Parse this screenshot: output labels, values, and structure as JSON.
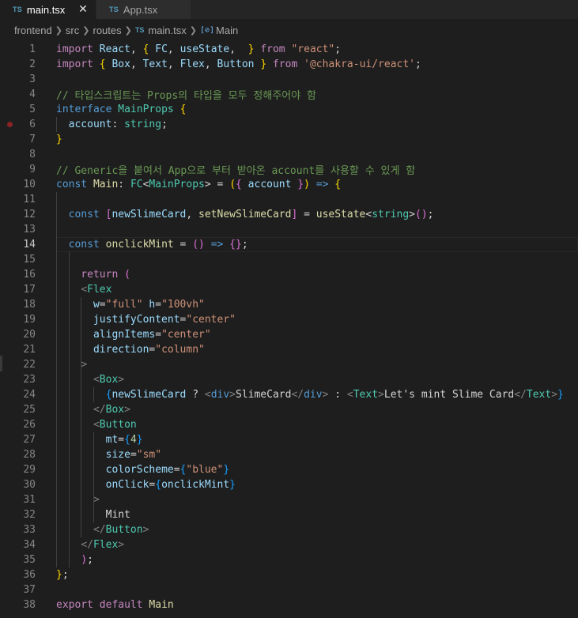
{
  "tabs": [
    {
      "badge": "TS",
      "label": "main.tsx",
      "active": true,
      "close": "✕"
    },
    {
      "badge": "TS",
      "label": "App.tsx",
      "active": false
    }
  ],
  "breadcrumb": {
    "parts": [
      "frontend",
      "src",
      "routes"
    ],
    "file_badge": "TS",
    "file": "main.tsx",
    "symbol_icon": "[⊘]",
    "symbol": "Main"
  },
  "editor": {
    "current_line": 14,
    "breakpoint_line": 6,
    "lines": [
      {
        "n": "1",
        "t": [
          [
            "ctl",
            "import"
          ],
          [
            "pl",
            " "
          ],
          [
            "var",
            "React"
          ],
          [
            "pl",
            ", "
          ],
          [
            "br1",
            "{"
          ],
          [
            "pl",
            " "
          ],
          [
            "var",
            "FC"
          ],
          [
            "pl",
            ", "
          ],
          [
            "var",
            "useState"
          ],
          [
            "pl",
            ",  "
          ],
          [
            "br1",
            "}"
          ],
          [
            "pl",
            " "
          ],
          [
            "ctl",
            "from"
          ],
          [
            "pl",
            " "
          ],
          [
            "str",
            "\"react\""
          ],
          [
            "pl",
            ";"
          ]
        ]
      },
      {
        "n": "2",
        "t": [
          [
            "ctl",
            "import"
          ],
          [
            "pl",
            " "
          ],
          [
            "br1",
            "{"
          ],
          [
            "pl",
            " "
          ],
          [
            "var",
            "Box"
          ],
          [
            "pl",
            ", "
          ],
          [
            "var",
            "Text"
          ],
          [
            "pl",
            ", "
          ],
          [
            "var",
            "Flex"
          ],
          [
            "pl",
            ", "
          ],
          [
            "var",
            "Button"
          ],
          [
            "pl",
            " "
          ],
          [
            "br1",
            "}"
          ],
          [
            "pl",
            " "
          ],
          [
            "ctl",
            "from"
          ],
          [
            "pl",
            " "
          ],
          [
            "str",
            "'@chakra-ui/react'"
          ],
          [
            "pl",
            ";"
          ]
        ]
      },
      {
        "n": "3",
        "t": []
      },
      {
        "n": "4",
        "t": [
          [
            "com",
            "// 타입스크립트는 Props의 타입을 모두 정해주어야 함"
          ]
        ]
      },
      {
        "n": "5",
        "t": [
          [
            "kw",
            "interface"
          ],
          [
            "pl",
            " "
          ],
          [
            "ty",
            "MainProps"
          ],
          [
            "pl",
            " "
          ],
          [
            "br1",
            "{"
          ]
        ]
      },
      {
        "n": "6",
        "t": [
          [
            "pl",
            "  "
          ],
          [
            "var",
            "account"
          ],
          [
            "pl",
            ": "
          ],
          [
            "ty",
            "string"
          ],
          [
            "pl",
            ";"
          ]
        ]
      },
      {
        "n": "7",
        "t": [
          [
            "br1",
            "}"
          ]
        ]
      },
      {
        "n": "8",
        "t": []
      },
      {
        "n": "9",
        "t": [
          [
            "com",
            "// Generic을 붙여서 App으로 부터 받아온 account를 사용할 수 있게 함"
          ]
        ]
      },
      {
        "n": "10",
        "t": [
          [
            "kw",
            "const"
          ],
          [
            "pl",
            " "
          ],
          [
            "fn",
            "Main"
          ],
          [
            "pl",
            ": "
          ],
          [
            "ty",
            "FC"
          ],
          [
            "pl",
            "<"
          ],
          [
            "ty",
            "MainProps"
          ],
          [
            "pl",
            "> = "
          ],
          [
            "br1",
            "("
          ],
          [
            "br2",
            "{"
          ],
          [
            "pl",
            " "
          ],
          [
            "var",
            "account"
          ],
          [
            "pl",
            " "
          ],
          [
            "br2",
            "}"
          ],
          [
            "br1",
            ")"
          ],
          [
            "pl",
            " "
          ],
          [
            "kw",
            "=>"
          ],
          [
            "pl",
            " "
          ],
          [
            "br1",
            "{"
          ]
        ]
      },
      {
        "n": "11",
        "t": []
      },
      {
        "n": "12",
        "t": [
          [
            "pl",
            "  "
          ],
          [
            "kw",
            "const"
          ],
          [
            "pl",
            " "
          ],
          [
            "br2",
            "["
          ],
          [
            "var",
            "newSlimeCard"
          ],
          [
            "pl",
            ", "
          ],
          [
            "fn",
            "setNewSlimeCard"
          ],
          [
            "br2",
            "]"
          ],
          [
            "pl",
            " = "
          ],
          [
            "fn",
            "useState"
          ],
          [
            "pl",
            "<"
          ],
          [
            "ty",
            "string"
          ],
          [
            "pl",
            ">"
          ],
          [
            "br2",
            "("
          ],
          [
            "br2",
            ")"
          ],
          [
            "pl",
            ";"
          ]
        ]
      },
      {
        "n": "13",
        "t": []
      },
      {
        "n": "14",
        "t": [
          [
            "pl",
            "  "
          ],
          [
            "kw",
            "const"
          ],
          [
            "pl",
            " "
          ],
          [
            "fn",
            "onclickMint"
          ],
          [
            "pl",
            " = "
          ],
          [
            "br2",
            "()"
          ],
          [
            "pl",
            " "
          ],
          [
            "kw",
            "=>"
          ],
          [
            "pl",
            " "
          ],
          [
            "br2",
            "{}"
          ],
          [
            "pl",
            ";"
          ]
        ]
      },
      {
        "n": "15",
        "t": []
      },
      {
        "n": "16",
        "t": [
          [
            "pl",
            "    "
          ],
          [
            "ctl",
            "return"
          ],
          [
            "pl",
            " "
          ],
          [
            "br2",
            "("
          ]
        ]
      },
      {
        "n": "17",
        "t": [
          [
            "pl",
            "    "
          ],
          [
            "ang",
            "<"
          ],
          [
            "tag",
            "Flex"
          ]
        ]
      },
      {
        "n": "18",
        "t": [
          [
            "pl",
            "      "
          ],
          [
            "attr",
            "w"
          ],
          [
            "pl",
            "="
          ],
          [
            "str",
            "\"full\""
          ],
          [
            "pl",
            " "
          ],
          [
            "attr",
            "h"
          ],
          [
            "pl",
            "="
          ],
          [
            "str",
            "\"100vh\""
          ]
        ]
      },
      {
        "n": "19",
        "t": [
          [
            "pl",
            "      "
          ],
          [
            "attr",
            "justifyContent"
          ],
          [
            "pl",
            "="
          ],
          [
            "str",
            "\"center\""
          ]
        ]
      },
      {
        "n": "20",
        "t": [
          [
            "pl",
            "      "
          ],
          [
            "attr",
            "alignItems"
          ],
          [
            "pl",
            "="
          ],
          [
            "str",
            "\"center\""
          ]
        ]
      },
      {
        "n": "21",
        "t": [
          [
            "pl",
            "      "
          ],
          [
            "attr",
            "direction"
          ],
          [
            "pl",
            "="
          ],
          [
            "str",
            "\"column\""
          ]
        ]
      },
      {
        "n": "22",
        "t": [
          [
            "pl",
            "    "
          ],
          [
            "ang",
            ">"
          ]
        ]
      },
      {
        "n": "23",
        "t": [
          [
            "pl",
            "      "
          ],
          [
            "ang",
            "<"
          ],
          [
            "tag",
            "Box"
          ],
          [
            "ang",
            ">"
          ]
        ]
      },
      {
        "n": "24",
        "t": [
          [
            "pl",
            "        "
          ],
          [
            "br3",
            "{"
          ],
          [
            "var",
            "newSlimeCard"
          ],
          [
            "pl",
            " ? "
          ],
          [
            "ang",
            "<"
          ],
          [
            "kw",
            "div"
          ],
          [
            "ang",
            ">"
          ],
          [
            "pl",
            "SlimeCard"
          ],
          [
            "ang",
            "</"
          ],
          [
            "kw",
            "div"
          ],
          [
            "ang",
            ">"
          ],
          [
            "pl",
            " : "
          ],
          [
            "ang",
            "<"
          ],
          [
            "tag",
            "Text"
          ],
          [
            "ang",
            ">"
          ],
          [
            "pl",
            "Let's mint Slime Card"
          ],
          [
            "ang",
            "</"
          ],
          [
            "tag",
            "Text"
          ],
          [
            "ang",
            ">"
          ],
          [
            "br3",
            "}"
          ]
        ]
      },
      {
        "n": "25",
        "t": [
          [
            "pl",
            "      "
          ],
          [
            "ang",
            "</"
          ],
          [
            "tag",
            "Box"
          ],
          [
            "ang",
            ">"
          ]
        ]
      },
      {
        "n": "26",
        "t": [
          [
            "pl",
            "      "
          ],
          [
            "ang",
            "<"
          ],
          [
            "tag",
            "Button"
          ]
        ]
      },
      {
        "n": "27",
        "t": [
          [
            "pl",
            "        "
          ],
          [
            "attr",
            "mt"
          ],
          [
            "pl",
            "="
          ],
          [
            "br3",
            "{"
          ],
          [
            "num",
            "4"
          ],
          [
            "br3",
            "}"
          ]
        ]
      },
      {
        "n": "28",
        "t": [
          [
            "pl",
            "        "
          ],
          [
            "attr",
            "size"
          ],
          [
            "pl",
            "="
          ],
          [
            "str",
            "\"sm\""
          ]
        ]
      },
      {
        "n": "29",
        "t": [
          [
            "pl",
            "        "
          ],
          [
            "attr",
            "colorScheme"
          ],
          [
            "pl",
            "="
          ],
          [
            "br3",
            "{"
          ],
          [
            "str",
            "\"blue\""
          ],
          [
            "br3",
            "}"
          ]
        ]
      },
      {
        "n": "30",
        "t": [
          [
            "pl",
            "        "
          ],
          [
            "attr",
            "onClick"
          ],
          [
            "pl",
            "="
          ],
          [
            "br3",
            "{"
          ],
          [
            "var",
            "onclickMint"
          ],
          [
            "br3",
            "}"
          ]
        ]
      },
      {
        "n": "31",
        "t": [
          [
            "pl",
            "      "
          ],
          [
            "ang",
            ">"
          ]
        ]
      },
      {
        "n": "32",
        "t": [
          [
            "pl",
            "        "
          ],
          [
            "pl",
            "Mint"
          ]
        ]
      },
      {
        "n": "33",
        "t": [
          [
            "pl",
            "      "
          ],
          [
            "ang",
            "</"
          ],
          [
            "tag",
            "Button"
          ],
          [
            "ang",
            ">"
          ]
        ]
      },
      {
        "n": "34",
        "t": [
          [
            "pl",
            "    "
          ],
          [
            "ang",
            "</"
          ],
          [
            "tag",
            "Flex"
          ],
          [
            "ang",
            ">"
          ]
        ]
      },
      {
        "n": "35",
        "t": [
          [
            "pl",
            "    "
          ],
          [
            "br2",
            ")"
          ],
          [
            "pl",
            ";"
          ]
        ]
      },
      {
        "n": "36",
        "t": [
          [
            "br1",
            "}"
          ],
          [
            "pl",
            ";"
          ]
        ]
      },
      {
        "n": "37",
        "t": []
      },
      {
        "n": "38",
        "t": [
          [
            "ctl",
            "export"
          ],
          [
            "pl",
            " "
          ],
          [
            "ctl",
            "default"
          ],
          [
            "pl",
            " "
          ],
          [
            "fn",
            "Main"
          ]
        ]
      }
    ]
  }
}
